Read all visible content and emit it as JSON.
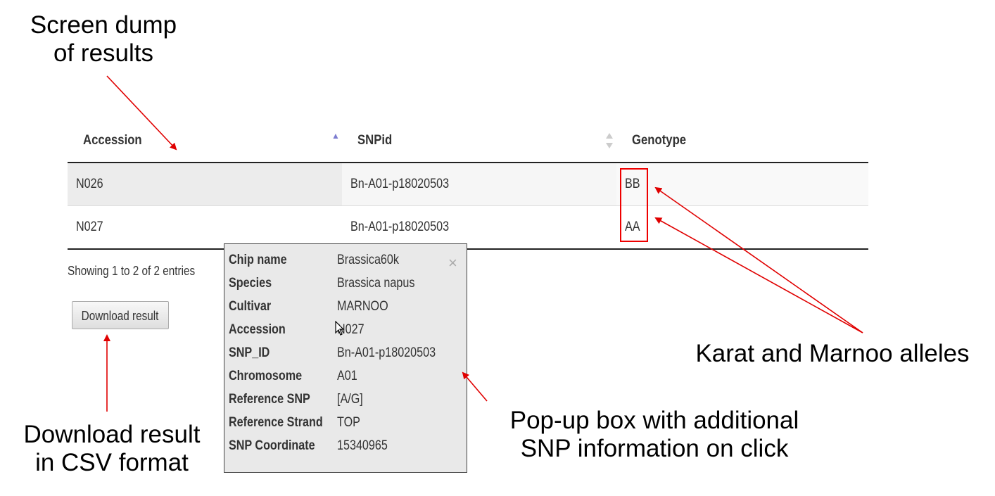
{
  "annotations": {
    "screen_dump": [
      "Screen dump",
      "of results"
    ],
    "download": [
      "Download result",
      "in CSV format"
    ],
    "popup": [
      "Pop-up box with additional",
      "SNP information on click"
    ],
    "alleles": "Karat and Marnoo alleles"
  },
  "table": {
    "headers": [
      "Accession",
      "SNPid",
      "Genotype"
    ],
    "rows": [
      [
        "N026",
        "Bn-A01-p18020503",
        "BB"
      ],
      [
        "N027",
        "Bn-A01-p18020503",
        "AA"
      ]
    ],
    "info": "Showing 1 to 2 of 2 entries",
    "sorted_column": "Accession"
  },
  "download_button": "Download result",
  "popup": {
    "close": "×",
    "fields": [
      {
        "key": "Chip name",
        "value": "Brassica60k"
      },
      {
        "key": "Species",
        "value": "Brassica napus"
      },
      {
        "key": "Cultivar",
        "value": "MARNOO"
      },
      {
        "key": "Accession",
        "value": "N027"
      },
      {
        "key": "SNP_ID",
        "value": "Bn-A01-p18020503"
      },
      {
        "key": "Chromosome",
        "value": "A01"
      },
      {
        "key": "Reference SNP",
        "value": "[A/G]"
      },
      {
        "key": "Reference Strand",
        "value": "TOP"
      },
      {
        "key": "SNP Coordinate",
        "value": "15340965"
      }
    ]
  },
  "colors": {
    "annotation_arrow": "#e00000",
    "sort_active": "#7c7cd0",
    "popup_bg": "#e9e9e9"
  },
  "icons": [
    "sort-ascending-icon",
    "sort-both-icon",
    "close-icon",
    "mouse-cursor-icon"
  ]
}
